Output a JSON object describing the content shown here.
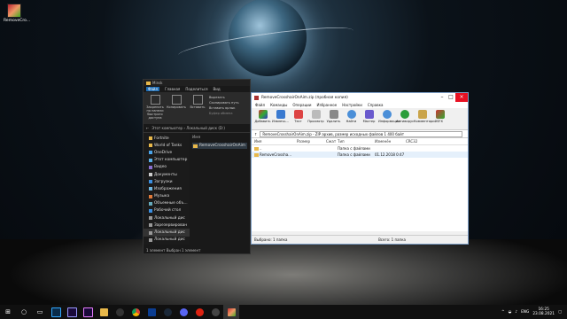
{
  "desktop": {
    "icon_label": "RemoveCro..."
  },
  "explorer": {
    "title": "Minsk",
    "tabs": [
      "Файл",
      "Главная",
      "Поделиться",
      "Вид"
    ],
    "ribbon": {
      "pin": "Закрепить на панели быстрого доступа",
      "copy": "Копировать",
      "paste": "Вставить",
      "cut": "Вырезать",
      "copy_path": "Скопировать путь",
      "paste_shortcut": "Вставить ярлык",
      "group": "Буфер обмена"
    },
    "address": "Этот компьютер › Локальный диск (D:)",
    "nav": [
      "Fortnite",
      "World of Tanks",
      "OneDrive",
      "Этот компьютер",
      "Видео",
      "Документы",
      "Загрузки",
      "Изображения",
      "Музыка",
      "Объемные объ...",
      "Рабочий стол",
      "Локальный дис",
      "Зарезервирован",
      "Локальный дис",
      "Локальный дис"
    ],
    "content_header": "Имя",
    "file": "RemoveCrosshairOnAim",
    "status": "1 элемент    Выбран 1 элемент"
  },
  "winrar": {
    "title": "RemoveCrosshairOnAim.zip (пробная копия)",
    "menu": [
      "Файл",
      "Команды",
      "Операции",
      "Избранное",
      "Настройки",
      "Справка"
    ],
    "toolbar": [
      "Добавить",
      "Извлечь...",
      "Тест",
      "Просмотр",
      "Удалить",
      "Найти",
      "Мастер",
      "Информация",
      "Антивирус",
      "Комментарий",
      "SFX"
    ],
    "path": "RemoveCrosshairOnAim.zip - ZIP архив, размер исходных файлов 1 400 байт",
    "columns": [
      "Имя",
      "Размер",
      "Сжат",
      "Тип",
      "Изменён",
      "CRC32"
    ],
    "rows": [
      {
        "name": "..",
        "size": "",
        "packed": "",
        "type": "Папка с файлами",
        "modified": "",
        "crc": ""
      },
      {
        "name": "RemoveCrossha...",
        "size": "",
        "packed": "",
        "type": "Папка с файлами",
        "modified": "01.12.2018 0:47",
        "crc": ""
      }
    ],
    "status_left": "Выбрано: 1 папка",
    "status_right": "Всего: 1 папка"
  },
  "taskbar": {
    "lang": "ENG",
    "time": "16:25",
    "date": "23.08.2021"
  },
  "colors": {
    "accent": "#1f6fb7",
    "close": "#e81123",
    "folder": "#e8b84a"
  }
}
